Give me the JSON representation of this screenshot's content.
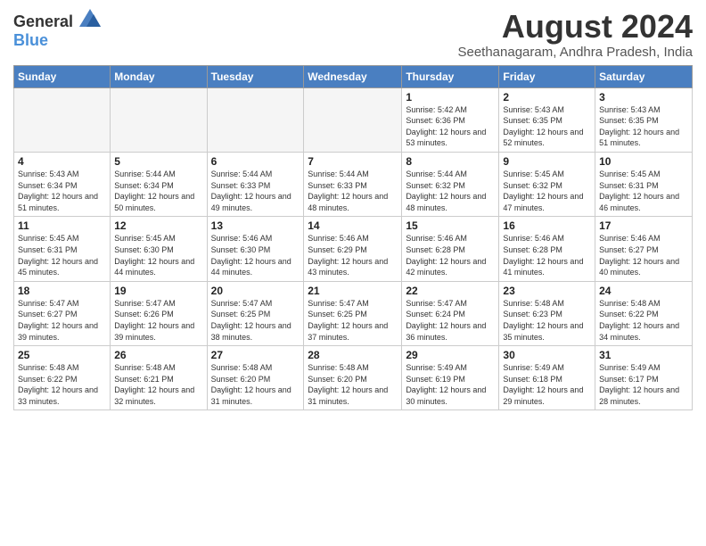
{
  "logo": {
    "general": "General",
    "blue": "Blue"
  },
  "title": "August 2024",
  "subtitle": "Seethanagaram, Andhra Pradesh, India",
  "days_of_week": [
    "Sunday",
    "Monday",
    "Tuesday",
    "Wednesday",
    "Thursday",
    "Friday",
    "Saturday"
  ],
  "weeks": [
    [
      {
        "day": "",
        "info": ""
      },
      {
        "day": "",
        "info": ""
      },
      {
        "day": "",
        "info": ""
      },
      {
        "day": "",
        "info": ""
      },
      {
        "day": "1",
        "info": "Sunrise: 5:42 AM\nSunset: 6:36 PM\nDaylight: 12 hours\nand 53 minutes."
      },
      {
        "day": "2",
        "info": "Sunrise: 5:43 AM\nSunset: 6:35 PM\nDaylight: 12 hours\nand 52 minutes."
      },
      {
        "day": "3",
        "info": "Sunrise: 5:43 AM\nSunset: 6:35 PM\nDaylight: 12 hours\nand 51 minutes."
      }
    ],
    [
      {
        "day": "4",
        "info": "Sunrise: 5:43 AM\nSunset: 6:34 PM\nDaylight: 12 hours\nand 51 minutes."
      },
      {
        "day": "5",
        "info": "Sunrise: 5:44 AM\nSunset: 6:34 PM\nDaylight: 12 hours\nand 50 minutes."
      },
      {
        "day": "6",
        "info": "Sunrise: 5:44 AM\nSunset: 6:33 PM\nDaylight: 12 hours\nand 49 minutes."
      },
      {
        "day": "7",
        "info": "Sunrise: 5:44 AM\nSunset: 6:33 PM\nDaylight: 12 hours\nand 48 minutes."
      },
      {
        "day": "8",
        "info": "Sunrise: 5:44 AM\nSunset: 6:32 PM\nDaylight: 12 hours\nand 48 minutes."
      },
      {
        "day": "9",
        "info": "Sunrise: 5:45 AM\nSunset: 6:32 PM\nDaylight: 12 hours\nand 47 minutes."
      },
      {
        "day": "10",
        "info": "Sunrise: 5:45 AM\nSunset: 6:31 PM\nDaylight: 12 hours\nand 46 minutes."
      }
    ],
    [
      {
        "day": "11",
        "info": "Sunrise: 5:45 AM\nSunset: 6:31 PM\nDaylight: 12 hours\nand 45 minutes."
      },
      {
        "day": "12",
        "info": "Sunrise: 5:45 AM\nSunset: 6:30 PM\nDaylight: 12 hours\nand 44 minutes."
      },
      {
        "day": "13",
        "info": "Sunrise: 5:46 AM\nSunset: 6:30 PM\nDaylight: 12 hours\nand 44 minutes."
      },
      {
        "day": "14",
        "info": "Sunrise: 5:46 AM\nSunset: 6:29 PM\nDaylight: 12 hours\nand 43 minutes."
      },
      {
        "day": "15",
        "info": "Sunrise: 5:46 AM\nSunset: 6:28 PM\nDaylight: 12 hours\nand 42 minutes."
      },
      {
        "day": "16",
        "info": "Sunrise: 5:46 AM\nSunset: 6:28 PM\nDaylight: 12 hours\nand 41 minutes."
      },
      {
        "day": "17",
        "info": "Sunrise: 5:46 AM\nSunset: 6:27 PM\nDaylight: 12 hours\nand 40 minutes."
      }
    ],
    [
      {
        "day": "18",
        "info": "Sunrise: 5:47 AM\nSunset: 6:27 PM\nDaylight: 12 hours\nand 39 minutes."
      },
      {
        "day": "19",
        "info": "Sunrise: 5:47 AM\nSunset: 6:26 PM\nDaylight: 12 hours\nand 39 minutes."
      },
      {
        "day": "20",
        "info": "Sunrise: 5:47 AM\nSunset: 6:25 PM\nDaylight: 12 hours\nand 38 minutes."
      },
      {
        "day": "21",
        "info": "Sunrise: 5:47 AM\nSunset: 6:25 PM\nDaylight: 12 hours\nand 37 minutes."
      },
      {
        "day": "22",
        "info": "Sunrise: 5:47 AM\nSunset: 6:24 PM\nDaylight: 12 hours\nand 36 minutes."
      },
      {
        "day": "23",
        "info": "Sunrise: 5:48 AM\nSunset: 6:23 PM\nDaylight: 12 hours\nand 35 minutes."
      },
      {
        "day": "24",
        "info": "Sunrise: 5:48 AM\nSunset: 6:22 PM\nDaylight: 12 hours\nand 34 minutes."
      }
    ],
    [
      {
        "day": "25",
        "info": "Sunrise: 5:48 AM\nSunset: 6:22 PM\nDaylight: 12 hours\nand 33 minutes."
      },
      {
        "day": "26",
        "info": "Sunrise: 5:48 AM\nSunset: 6:21 PM\nDaylight: 12 hours\nand 32 minutes."
      },
      {
        "day": "27",
        "info": "Sunrise: 5:48 AM\nSunset: 6:20 PM\nDaylight: 12 hours\nand 31 minutes."
      },
      {
        "day": "28",
        "info": "Sunrise: 5:48 AM\nSunset: 6:20 PM\nDaylight: 12 hours\nand 31 minutes."
      },
      {
        "day": "29",
        "info": "Sunrise: 5:49 AM\nSunset: 6:19 PM\nDaylight: 12 hours\nand 30 minutes."
      },
      {
        "day": "30",
        "info": "Sunrise: 5:49 AM\nSunset: 6:18 PM\nDaylight: 12 hours\nand 29 minutes."
      },
      {
        "day": "31",
        "info": "Sunrise: 5:49 AM\nSunset: 6:17 PM\nDaylight: 12 hours\nand 28 minutes."
      }
    ]
  ]
}
